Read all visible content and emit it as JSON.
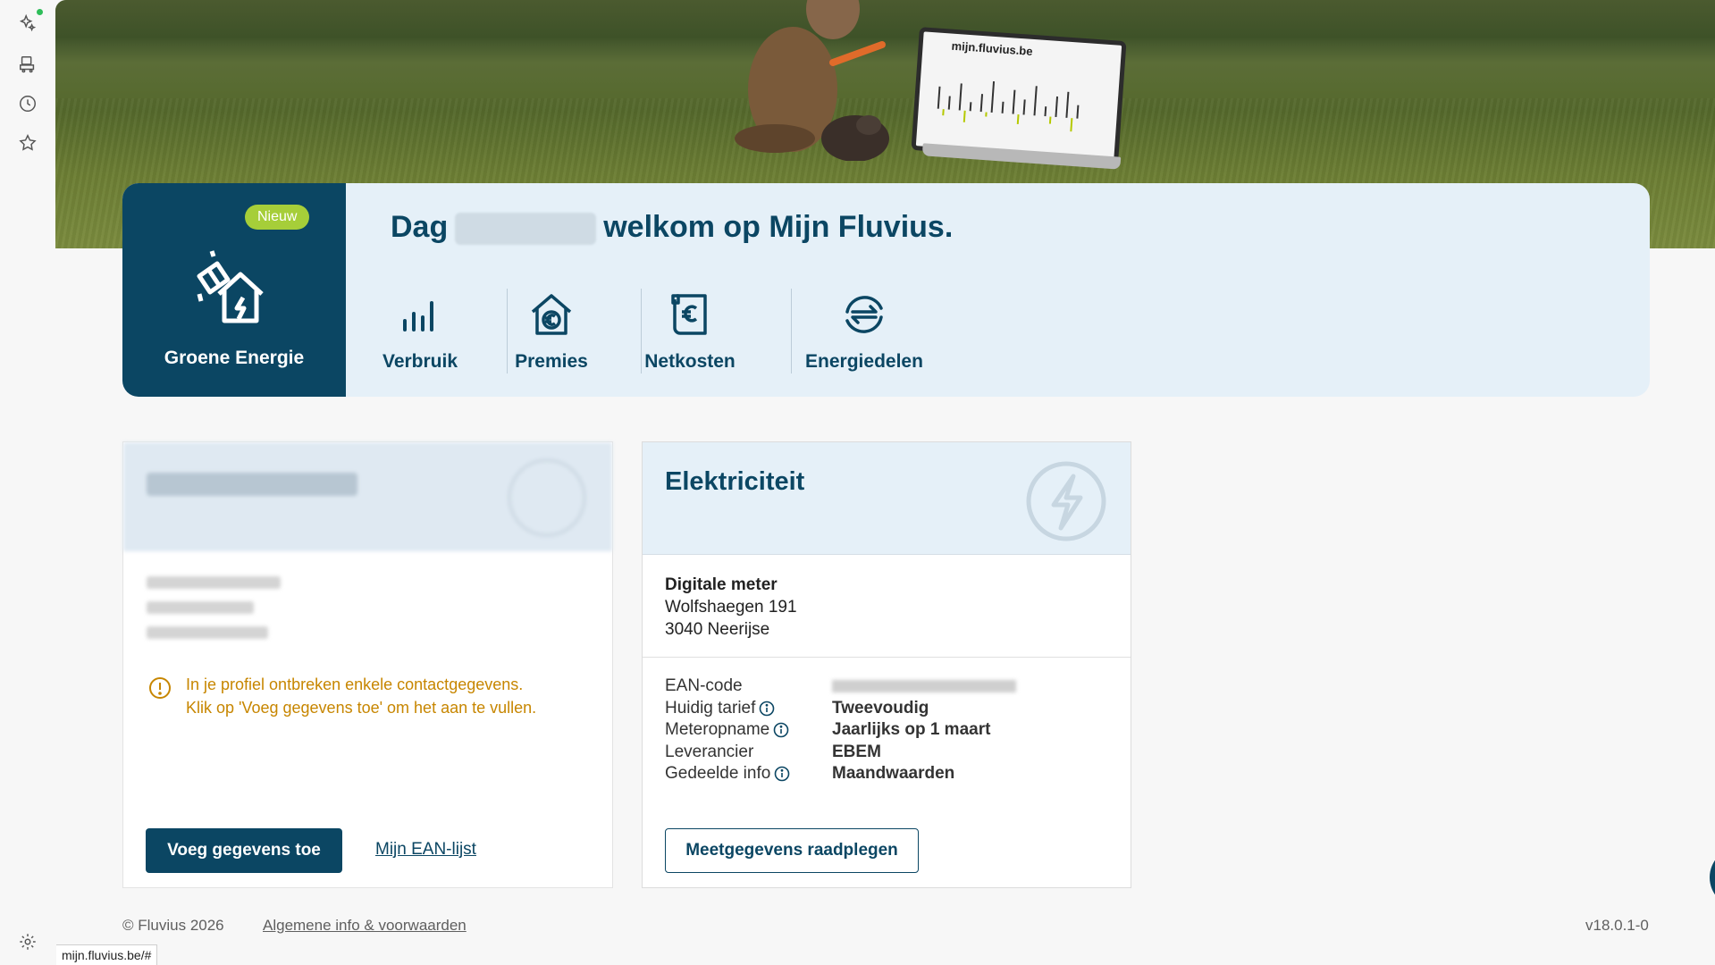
{
  "rail": {
    "icons": [
      "sparkle-icon",
      "cart-icon",
      "history-icon",
      "favorites-star-icon",
      "settings-gear-icon"
    ]
  },
  "hero": {
    "laptop_screen_text": "mijn.fluvius.be"
  },
  "welcome": {
    "new_badge": "Nieuw",
    "green_tile_label": "Groene Energie",
    "greeting_prefix": "Dag",
    "greeting_suffix": "welkom op Mijn Fluvius.",
    "shortcuts": [
      {
        "label": "Verbruik",
        "icon": "bar-chart-icon"
      },
      {
        "label": "Premies",
        "icon": "house-euro-icon"
      },
      {
        "label": "Netkosten",
        "icon": "invoice-euro-icon"
      },
      {
        "label": "Energiedelen",
        "icon": "energy-share-icon"
      }
    ]
  },
  "profile": {
    "warning_line1": "In je profiel ontbreken enkele contactgegevens.",
    "warning_line2": "Klik op 'Voeg gegevens toe' om het aan te vullen.",
    "add_button": "Voeg gegevens toe",
    "ean_link": "Mijn EAN-lijst"
  },
  "electricity": {
    "title": "Elektriciteit",
    "meter_type": "Digitale meter",
    "address_line1": "Wolfshaegen 191",
    "address_line2": "3040 Neerijse",
    "rows": [
      {
        "key": "EAN-code",
        "value": "",
        "blurred": true,
        "info": false
      },
      {
        "key": "Huidig tarief",
        "value": "Tweevoudig",
        "info": true
      },
      {
        "key": "Meteropname",
        "value": "Jaarlijks op 1 maart",
        "info": true
      },
      {
        "key": "Leverancier",
        "value": "EBEM",
        "info": false
      },
      {
        "key": "Gedeelde info",
        "value": "Maandwaarden",
        "info": true
      }
    ],
    "button": "Meetgegevens raadplegen"
  },
  "footer": {
    "copyright": "© Fluvius 2026",
    "terms_link": "Algemene info & voorwaarden",
    "version": "v18.0.1-0"
  },
  "status_url": "mijn.fluvius.be/#",
  "colors": {
    "brand_dark": "#0b4663",
    "accent_green": "#a6ce39",
    "light_blue": "#e5f0f8",
    "warning": "#c78600"
  }
}
